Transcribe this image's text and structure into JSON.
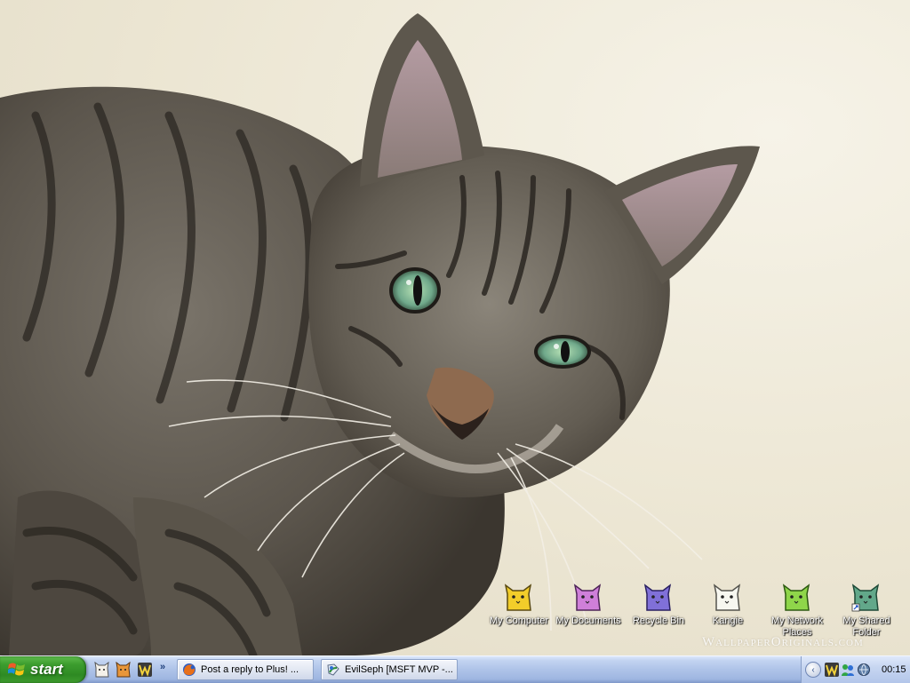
{
  "desktop": {
    "watermark": "WallpaperOriginals.com",
    "icons": [
      {
        "label": "My Computer",
        "icon": "cat-icon",
        "color": "#f2cd2a"
      },
      {
        "label": "My Documents",
        "icon": "cat-icon",
        "color": "#cf7fd9"
      },
      {
        "label": "Recycle Bin",
        "icon": "cat-icon",
        "color": "#8070d8"
      },
      {
        "label": "Kangie",
        "icon": "cat-icon",
        "color": "#f7f7f0"
      },
      {
        "label": "My Network Places",
        "icon": "cat-icon",
        "color": "#8fd64a"
      },
      {
        "label": "My Shared Folder",
        "icon": "cat-icon",
        "color": "#62a88a"
      }
    ]
  },
  "taskbar": {
    "start_label": "start",
    "quicklaunch_more": "»",
    "tasks": [
      {
        "label": "Post a reply to Plus! ...",
        "icon": "firefox-icon"
      },
      {
        "label": "EvilSeph [MSFT MVP -...",
        "icon": "messenger-plus-icon"
      }
    ],
    "tray": {
      "collapse_glyph": "‹",
      "clock": "00:15"
    }
  },
  "colors": {
    "taskbar": "#aec3e8",
    "start_green": "#3c9d2e",
    "wallpaper_cream": "#ece6d3"
  }
}
